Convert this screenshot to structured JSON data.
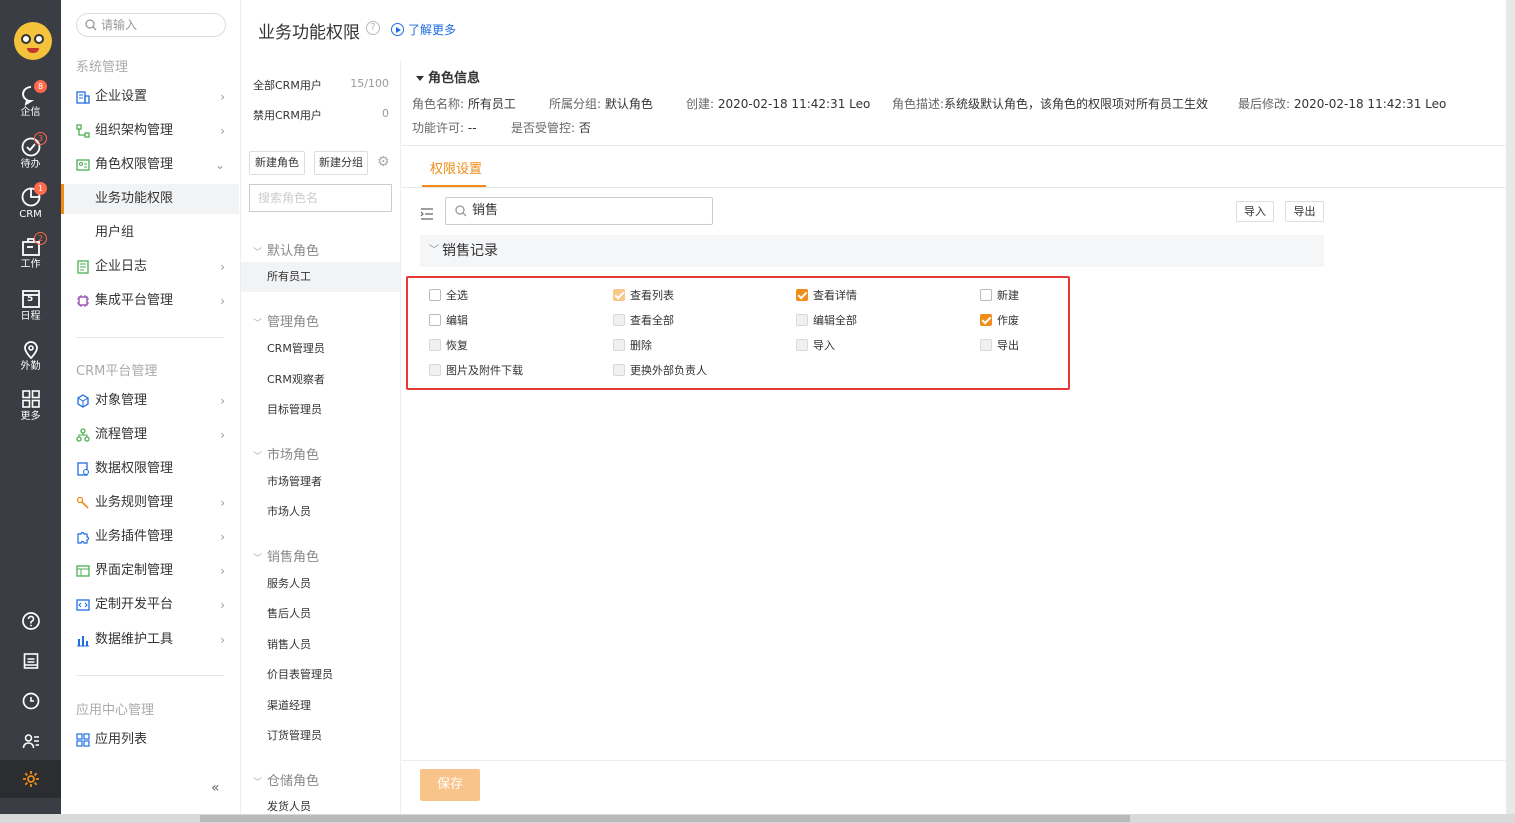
{
  "rail": {
    "items": [
      {
        "label": "企信",
        "badge": "8"
      },
      {
        "label": "待办",
        "badge": "3"
      },
      {
        "label": "CRM",
        "badge": "1"
      },
      {
        "label": "工作",
        "badge": "2"
      },
      {
        "label": "日程",
        "badge": ""
      },
      {
        "label": "外勤",
        "badge": ""
      },
      {
        "label": "更多",
        "badge": ""
      }
    ],
    "calendar_day": "5"
  },
  "sidenav": {
    "search_placeholder": "请输入",
    "sections": [
      {
        "title": "系统管理",
        "items": [
          "企业设置",
          "组织架构管理",
          "角色权限管理",
          "业务功能权限",
          "用户组",
          "企业日志",
          "集成平台管理"
        ]
      },
      {
        "title": "CRM平台管理",
        "items": [
          "对象管理",
          "流程管理",
          "数据权限管理",
          "业务规则管理",
          "业务插件管理",
          "界面定制管理",
          "定制开发平台",
          "数据维护工具"
        ]
      },
      {
        "title": "应用中心管理",
        "items": [
          "应用列表"
        ]
      }
    ],
    "collapse": "«"
  },
  "header": {
    "title": "业务功能权限",
    "help": "?",
    "learn_more": "了解更多"
  },
  "roles": {
    "stats": [
      {
        "label": "全部CRM用户",
        "value": "15/100"
      },
      {
        "label": "禁用CRM用户",
        "value": "0"
      }
    ],
    "new_role": "新建角色",
    "new_group": "新建分组",
    "search_placeholder": "搜索角色名",
    "groups": [
      {
        "title": "默认角色",
        "roles": [
          "所有员工"
        ]
      },
      {
        "title": "管理角色",
        "roles": [
          "CRM管理员",
          "CRM观察者",
          "目标管理员"
        ]
      },
      {
        "title": "市场角色",
        "roles": [
          "市场管理者",
          "市场人员"
        ]
      },
      {
        "title": "销售角色",
        "roles": [
          "服务人员",
          "售后人员",
          "销售人员",
          "价目表管理员",
          "渠道经理",
          "订货管理员"
        ]
      },
      {
        "title": "仓储角色",
        "roles": [
          "发货人员"
        ]
      }
    ]
  },
  "role_info": {
    "section_title": "角色信息",
    "name_k": "角色名称:",
    "name_v": "所有员工",
    "group_k": "所属分组:",
    "group_v": "默认角色",
    "created_k": "创建:",
    "created_v": "2020-02-18 11:42:31 Leo",
    "desc_k": "角色描述:",
    "desc_v": "系统级默认角色，该角色的权限项对所有员工生效",
    "modified_k": "最后修改:",
    "modified_v": "2020-02-18 11:42:31 Leo",
    "license_k": "功能许可:",
    "license_v": "--",
    "controlled_k": "是否受管控:",
    "controlled_v": "否"
  },
  "perm": {
    "tab": "权限设置",
    "search_value": "销售",
    "import": "导入",
    "export": "导出",
    "group_title": "销售记录",
    "checkboxes": [
      {
        "label": "全选",
        "state": "off"
      },
      {
        "label": "查看列表",
        "state": "on-disabled"
      },
      {
        "label": "查看详情",
        "state": "on"
      },
      {
        "label": "新建",
        "state": "off"
      },
      {
        "label": "编辑",
        "state": "off"
      },
      {
        "label": "查看全部",
        "state": "disabled"
      },
      {
        "label": "编辑全部",
        "state": "disabled"
      },
      {
        "label": "作废",
        "state": "on"
      },
      {
        "label": "恢复",
        "state": "disabled"
      },
      {
        "label": "删除",
        "state": "disabled"
      },
      {
        "label": "导入",
        "state": "disabled"
      },
      {
        "label": "导出",
        "state": "disabled"
      },
      {
        "label": "图片及附件下载",
        "state": "disabled"
      },
      {
        "label": "更换外部负责人",
        "state": "disabled"
      }
    ],
    "save": "保存"
  },
  "colors": {
    "accent": "#f08c18",
    "rail": "#3a3d43",
    "highlight_border": "#e53935",
    "link": "#1f6de0"
  }
}
